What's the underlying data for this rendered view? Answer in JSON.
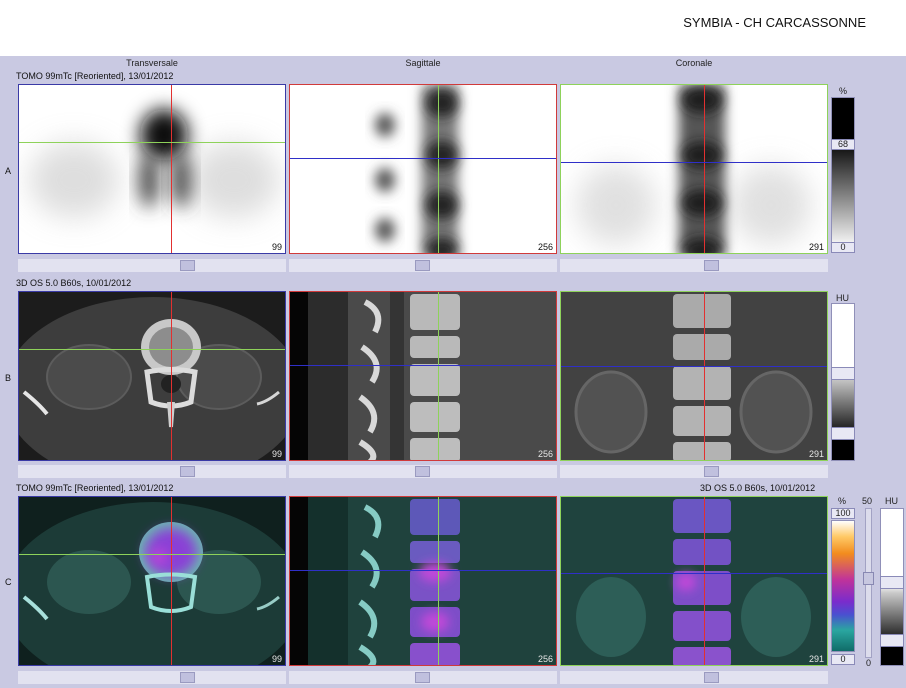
{
  "header": {
    "site": "SYMBIA - CH CARCASSONNE"
  },
  "columns": {
    "transverse": "Transversale",
    "sagittal": "Sagittale",
    "coronal": "Coronale"
  },
  "rows": {
    "a": {
      "letter": "A",
      "series": "TOMO 99mTc [Reoriented], 13/01/2012"
    },
    "b": {
      "letter": "B",
      "series": "3D  OS  5.0  B60s, 10/01/2012"
    },
    "c": {
      "letter": "C",
      "series_left": "TOMO 99mTc [Reoriented], 13/01/2012",
      "series_right": "3D  OS  5.0  B60s, 10/01/2012"
    }
  },
  "slices": {
    "transverse": "99",
    "sagittal": "256",
    "coronal": "291"
  },
  "colorbars": {
    "a": {
      "unit": "%",
      "top_value": "68",
      "bottom_value": "0"
    },
    "b": {
      "unit": "HU"
    },
    "c": {
      "unit_pct": "%",
      "top_value": "100",
      "bottom_value": "0",
      "slider_top": "50",
      "slider_bottom": "0",
      "unit_hu": "HU"
    }
  },
  "colors": {
    "workspace": "#c9c9e2",
    "crosshair_red": "#e23030",
    "crosshair_green": "#8ed25a",
    "crosshair_blue": "#2f2fc8",
    "fusion_spine": "#8a3fd6"
  }
}
